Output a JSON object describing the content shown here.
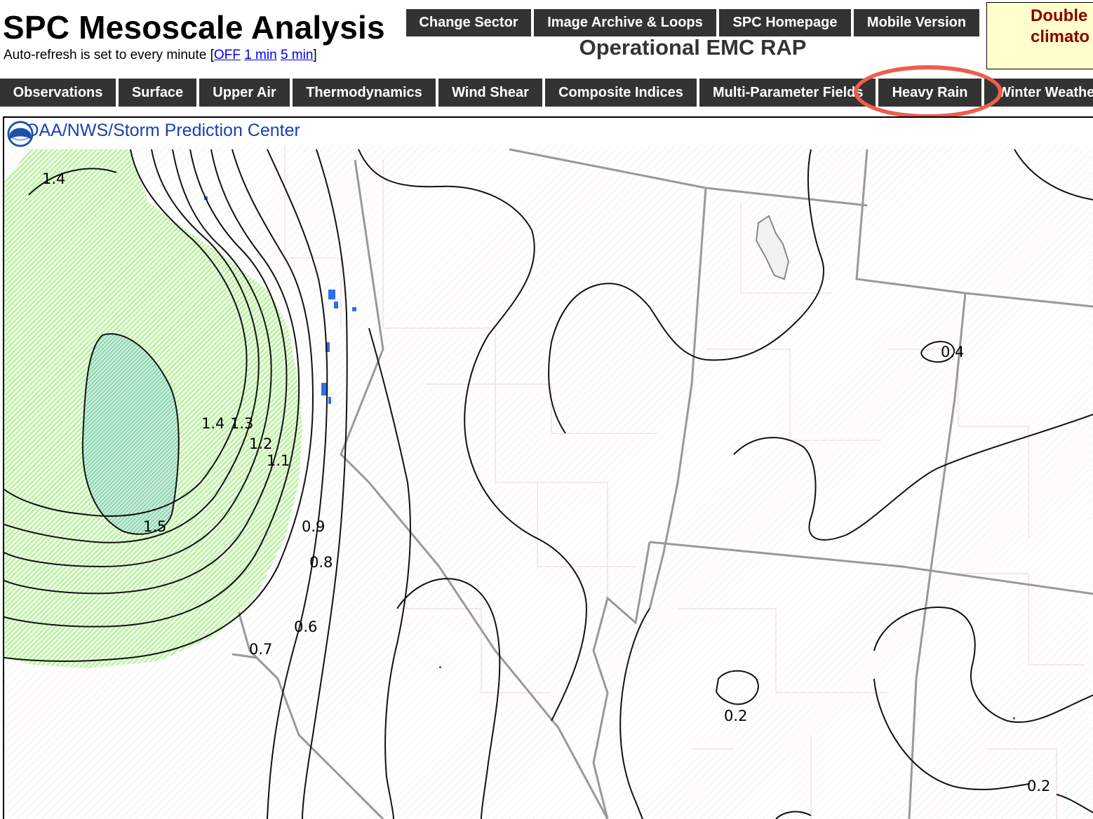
{
  "header": {
    "title": "SPC Mesoscale Analysis",
    "refresh_prefix": "Auto-refresh is set to every minute [",
    "refresh_suffix": "]",
    "refresh_options": [
      "OFF",
      "1 min",
      "5 min"
    ]
  },
  "top_buttons": [
    "Change Sector",
    "Image Archive & Loops",
    "SPC Homepage",
    "Mobile Version"
  ],
  "model_name": "Operational EMC RAP",
  "notice": {
    "lines": [
      "Double",
      "climato"
    ]
  },
  "nav_tabs": [
    "Observations",
    "Surface",
    "Upper Air",
    "Thermodynamics",
    "Wind Shear",
    "Composite Indices",
    "Multi-Parameter Fields",
    "Heavy Rain",
    "Winter Weather"
  ],
  "highlighted_tab": "Heavy Rain",
  "map": {
    "credit": "NOAA/NWS/Storm Prediction Center",
    "contour_labels": [
      "1.4",
      "1.4",
      "1.3",
      "1.2",
      "1.1",
      "1.5",
      "0.9",
      "0.8",
      "0.6",
      "0.7",
      "0.4",
      "0.2",
      "0.2"
    ]
  },
  "colors": {
    "button_bg": "#333333",
    "highlight_ring": "#ef5d4d",
    "link": "#0000ee",
    "notice_bg": "#ffffcc",
    "notice_text": "#8b0000",
    "credit_text": "#1b3fb0",
    "fill_light": "#b8f59a",
    "fill_dark": "#7fd4a0"
  }
}
